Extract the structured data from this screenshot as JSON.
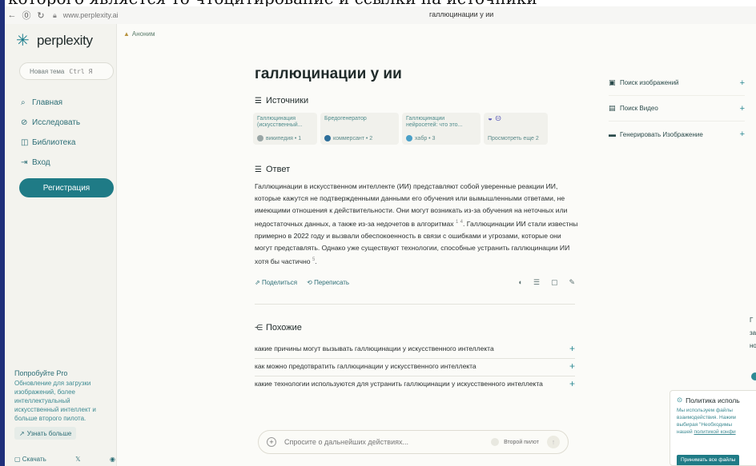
{
  "overlay_caption": "которого является то чтоцитирование и ссылки на источники",
  "browser": {
    "url": "www.perplexity.ai",
    "tab_title": "галлюцинации у ии"
  },
  "sidebar": {
    "logo_text": "perplexity",
    "new_thread_label": "Новая тема",
    "new_thread_shortcut": "Ctrl Я",
    "nav": [
      {
        "label": "Главная",
        "icon": "search-icon"
      },
      {
        "label": "Исследовать",
        "icon": "compass-icon"
      },
      {
        "label": "Библиотека",
        "icon": "library-icon"
      },
      {
        "label": "Вход",
        "icon": "login-icon"
      }
    ],
    "register_label": "Регистрация",
    "promo": {
      "title": "Попробуйте Pro",
      "body": "Обновление для загрузки изображений, более интеллектуальный искусственный интеллект и больше второго пилота.",
      "cta": "Узнать больше"
    },
    "download_label": "Скачать"
  },
  "header": {
    "user_label": "Аноним"
  },
  "main": {
    "title": "галлюцинации у ии",
    "sources_heading": "Источники",
    "sources": [
      {
        "title": "Галлюцинация (искусственный...",
        "meta": "википедия • 1",
        "dot_color": "#9aa6a6"
      },
      {
        "title": "Бредогенератор",
        "meta": "коммерсант • 2",
        "dot_color": "#2d6e9a"
      },
      {
        "title": "Галлюцинации нейросетей: что это...",
        "meta": "хабр • 3",
        "dot_color": "#4aa0c8"
      }
    ],
    "sources_more": "Просмотреть еще 2",
    "answer_heading": "Ответ",
    "answer_parts": [
      "Галлюцинации в искусственном интеллекте (ИИ) представляют собой уверенные реакции ИИ, которые кажутся не подтвержденными данными его обучения или вымышленными ответами, не имеющими отношения к действительности. Они могут возникать из-за обучения на неточных или недостаточных данных, а также из-за недочетов в алгоритмах",
      "1",
      "4",
      ". Галлюцинации ИИ стали известны примерно в 2022 году и вызвали обеспокоенность в связи с ошибками и угрозами, которые они могут представлять. Однако уже существуют технологии, способные устранить галлюцинации ИИ хотя бы частично",
      "5",
      "."
    ],
    "share_label": "Поделиться",
    "rewrite_label": "Переписать",
    "related_heading": "Похожие",
    "related": [
      "какие причины могут вызывать галлюцинации у искусственного интеллекта",
      "как можно предотвратить галлюцинации у искусственного интеллекта",
      "какие технологии используются для устранить галлюцинации у искусственного интеллекта"
    ],
    "followup_placeholder": "Спросите о дальнейших действиях...",
    "copilot_label": "Второй пилот"
  },
  "right_panel": {
    "items": [
      {
        "label": "Поиск изображений",
        "icon": "image-icon"
      },
      {
        "label": "Поиск Видео",
        "icon": "video-icon"
      },
      {
        "label": "Генерировать Изображение",
        "icon": "generate-image-icon"
      }
    ],
    "edge_fragments": [
      "Г",
      "за",
      "но"
    ]
  },
  "cookie": {
    "title": "Политика исполь",
    "lines": [
      "Мы используем файлы",
      "взаимодействия. Нажим",
      "выбирая \"Необходимы"
    ],
    "link_prefix": "нашей ",
    "link_text": "политикой конфи",
    "accept_label": "Принимать все файлы"
  }
}
